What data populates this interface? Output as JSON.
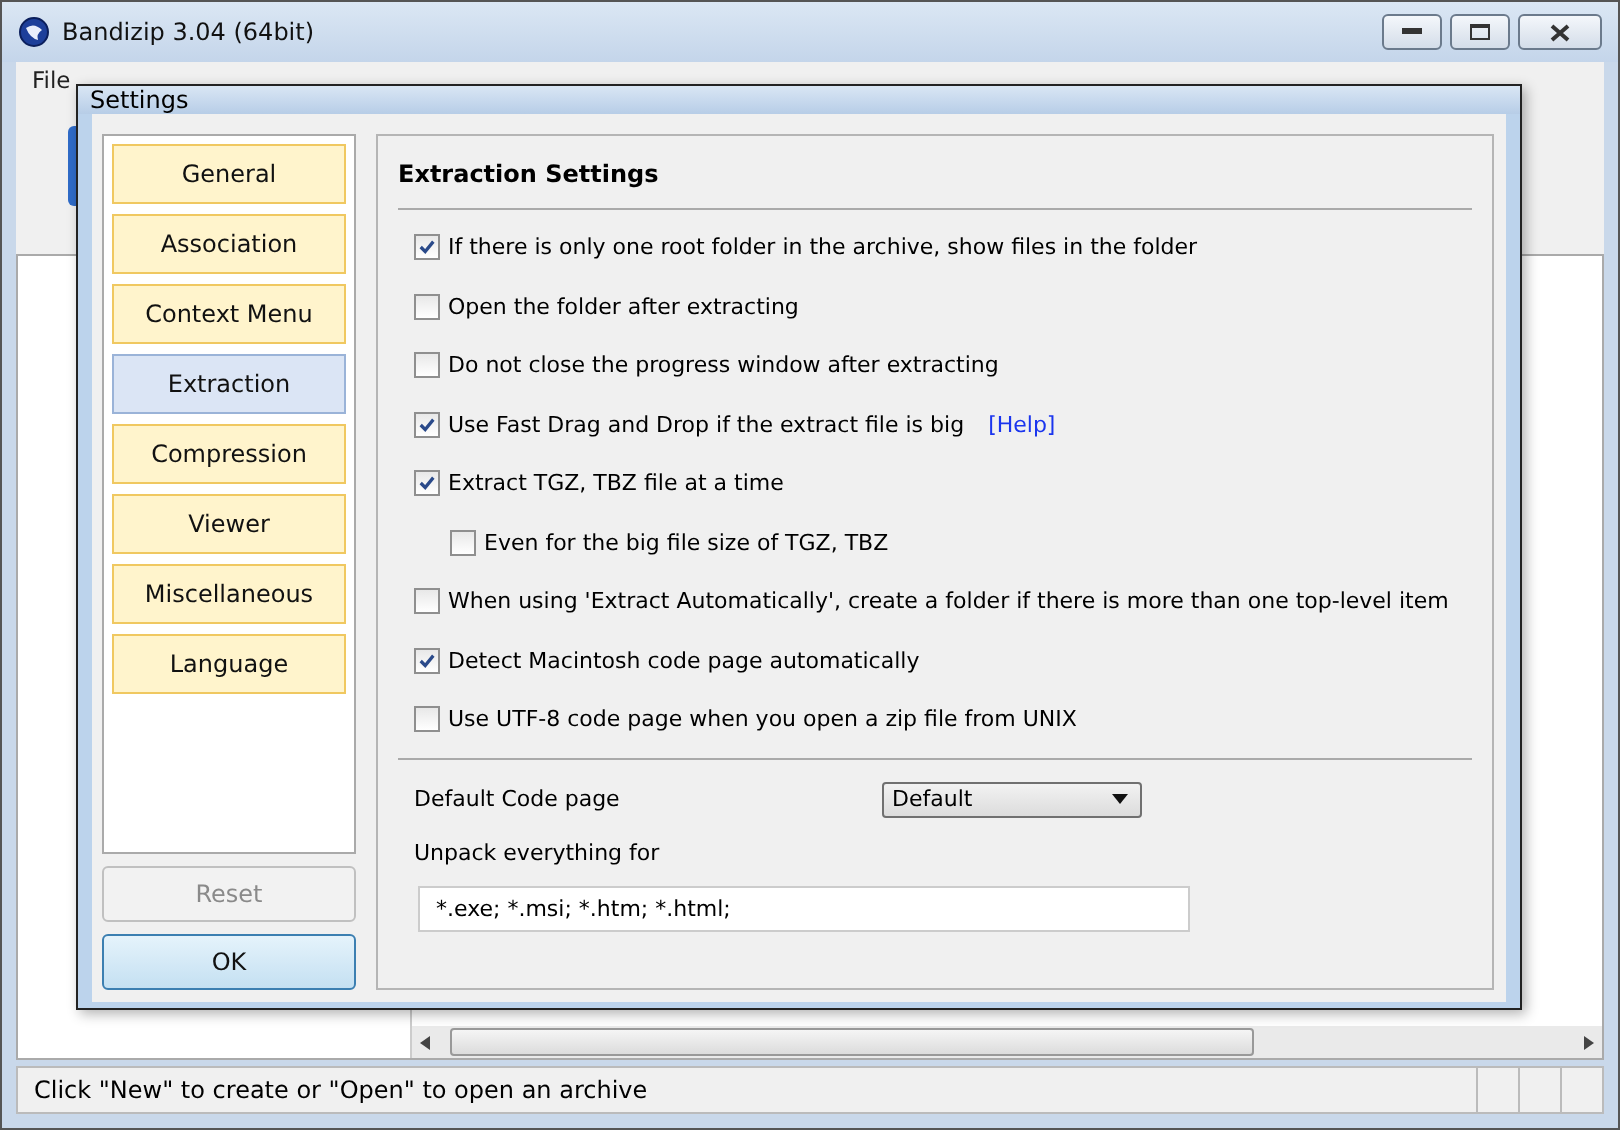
{
  "window": {
    "title": "Bandizip 3.04 (64bit)"
  },
  "menu": [
    "File"
  ],
  "status_bar": "Click \"New\" to create or \"Open\" to open an archive",
  "dialog": {
    "title": "Settings",
    "nav": [
      {
        "label": "General",
        "selected": false
      },
      {
        "label": "Association",
        "selected": false
      },
      {
        "label": "Context Menu",
        "selected": false
      },
      {
        "label": "Extraction",
        "selected": true
      },
      {
        "label": "Compression",
        "selected": false
      },
      {
        "label": "Viewer",
        "selected": false
      },
      {
        "label": "Miscellaneous",
        "selected": false
      },
      {
        "label": "Language",
        "selected": false
      }
    ],
    "reset": {
      "label": "Reset",
      "disabled": true
    },
    "ok": "OK",
    "heading": "Extraction Settings",
    "options": [
      {
        "label": "If there is only one root folder in the archive, show files in the folder",
        "checked": true
      },
      {
        "label": "Open the folder after extracting",
        "checked": false
      },
      {
        "label": "Do not close the progress window after extracting",
        "checked": false
      },
      {
        "label": "Use Fast Drag and Drop if the extract file is big",
        "checked": true,
        "link": "[Help]"
      },
      {
        "label": "Extract TGZ, TBZ file at a time",
        "checked": true,
        "children": [
          {
            "label": "Even for the big file size of TGZ, TBZ",
            "checked": false
          }
        ]
      },
      {
        "label": "When using 'Extract Automatically', create a folder if there is more than one top-level item",
        "checked": false
      },
      {
        "label": "Detect Macintosh code page automatically",
        "checked": true
      },
      {
        "label": "Use UTF-8 code page when you open a zip file from UNIX",
        "checked": false
      }
    ],
    "code_page": {
      "label": "Default Code page",
      "value": "Default"
    },
    "unpack": {
      "label": "Unpack everything for",
      "value": "*.exe; *.msi; *.htm; *.html;"
    }
  }
}
